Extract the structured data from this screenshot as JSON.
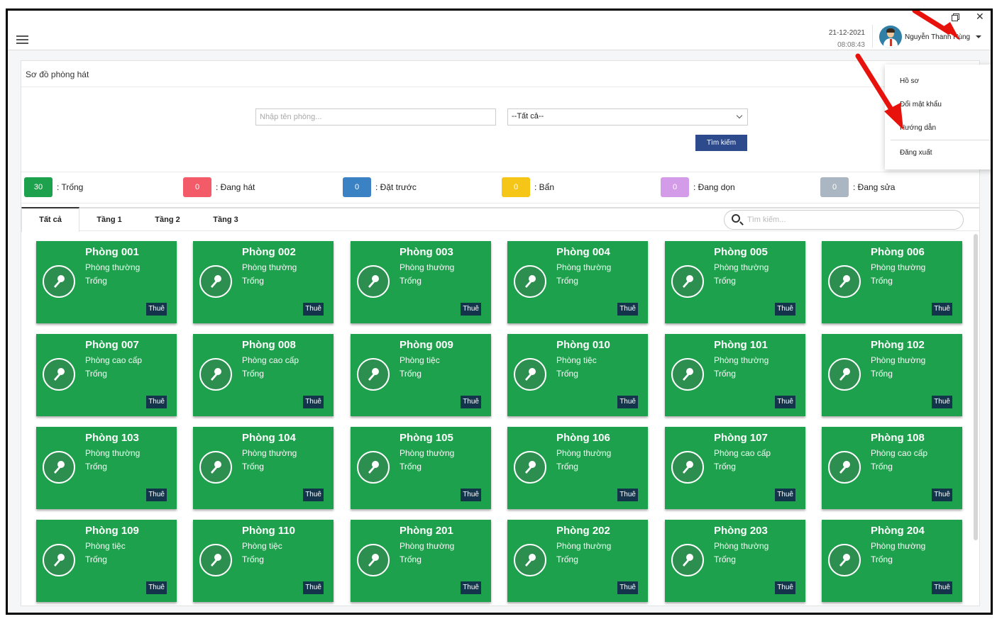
{
  "header": {
    "date": "21-12-2021",
    "time": "08:08:43",
    "user_name": "Nguyễn Thanh Hùng"
  },
  "user_menu": {
    "items": [
      "Hồ sơ",
      "Đổi mật khẩu",
      "Hướng dẫn",
      "Đăng xuất"
    ]
  },
  "page": {
    "title": "Sơ đồ phòng hát",
    "search_placeholder": "Nhập tên phòng...",
    "filter_value": "--Tất cả--",
    "search_button": "Tìm kiếm"
  },
  "legend": [
    {
      "count": "30",
      "label": ": Trống",
      "color": "#1ea14d"
    },
    {
      "count": "0",
      "label": ": Đang hát",
      "color": "#f45b69"
    },
    {
      "count": "0",
      "label": ": Đặt trước",
      "color": "#3b82c4"
    },
    {
      "count": "0",
      "label": ": Bẩn",
      "color": "#f5c518"
    },
    {
      "count": "0",
      "label": ": Đang dọn",
      "color": "#d49be8"
    },
    {
      "count": "0",
      "label": ": Đang sửa",
      "color": "#aab6c1"
    }
  ],
  "tabs": [
    "Tất cả",
    "Tầng 1",
    "Tầng 2",
    "Tầng 3"
  ],
  "room_search_placeholder": "Tìm kiếm...",
  "rent_label": "Thuê",
  "rooms": [
    {
      "name": "Phòng 001",
      "type": "Phòng thường",
      "status": "Trống"
    },
    {
      "name": "Phòng 002",
      "type": "Phòng thường",
      "status": "Trống"
    },
    {
      "name": "Phòng 003",
      "type": "Phòng thường",
      "status": "Trống"
    },
    {
      "name": "Phòng 004",
      "type": "Phòng thường",
      "status": "Trống"
    },
    {
      "name": "Phòng 005",
      "type": "Phòng thường",
      "status": "Trống"
    },
    {
      "name": "Phòng 006",
      "type": "Phòng thường",
      "status": "Trống"
    },
    {
      "name": "Phòng 007",
      "type": "Phòng cao cấp",
      "status": "Trống"
    },
    {
      "name": "Phòng 008",
      "type": "Phòng cao cấp",
      "status": "Trống"
    },
    {
      "name": "Phòng 009",
      "type": "Phòng tiệc",
      "status": "Trống"
    },
    {
      "name": "Phòng 010",
      "type": "Phòng tiệc",
      "status": "Trống"
    },
    {
      "name": "Phòng 101",
      "type": "Phòng thường",
      "status": "Trống"
    },
    {
      "name": "Phòng 102",
      "type": "Phòng thường",
      "status": "Trống"
    },
    {
      "name": "Phòng 103",
      "type": "Phòng thường",
      "status": "Trống"
    },
    {
      "name": "Phòng 104",
      "type": "Phòng thường",
      "status": "Trống"
    },
    {
      "name": "Phòng 105",
      "type": "Phòng thường",
      "status": "Trống"
    },
    {
      "name": "Phòng 106",
      "type": "Phòng thường",
      "status": "Trống"
    },
    {
      "name": "Phòng 107",
      "type": "Phòng cao cấp",
      "status": "Trống"
    },
    {
      "name": "Phòng 108",
      "type": "Phòng cao cấp",
      "status": "Trống"
    },
    {
      "name": "Phòng 109",
      "type": "Phòng tiệc",
      "status": "Trống"
    },
    {
      "name": "Phòng 110",
      "type": "Phòng tiệc",
      "status": "Trống"
    },
    {
      "name": "Phòng 201",
      "type": "Phòng thường",
      "status": "Trống"
    },
    {
      "name": "Phòng 202",
      "type": "Phòng thường",
      "status": "Trống"
    },
    {
      "name": "Phòng 203",
      "type": "Phòng thường",
      "status": "Trống"
    },
    {
      "name": "Phòng 204",
      "type": "Phòng thường",
      "status": "Trống"
    }
  ],
  "colors": {
    "room_available": "#1ea14d",
    "primary_button": "#2c4a8c",
    "annotation_arrow": "#e8120c"
  }
}
